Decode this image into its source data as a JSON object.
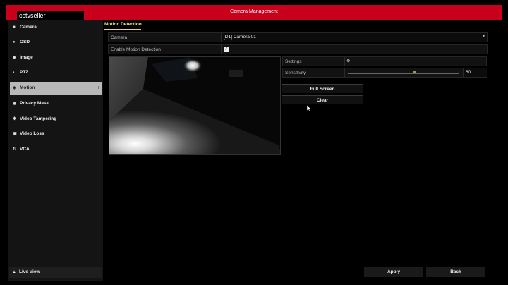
{
  "header": {
    "title": "Camera Management",
    "watermark": "cctvseller"
  },
  "sidebar": {
    "items": [
      {
        "label": "Camera",
        "icon": "camera-icon"
      },
      {
        "label": "OSD",
        "icon": "osd-icon"
      },
      {
        "label": "Image",
        "icon": "image-icon"
      },
      {
        "label": "PTZ",
        "icon": "ptz-icon"
      },
      {
        "label": "Motion",
        "icon": "motion-icon",
        "active": true
      },
      {
        "label": "Privacy Mask",
        "icon": "privacy-mask-icon"
      },
      {
        "label": "Video Tampering",
        "icon": "video-tampering-icon"
      },
      {
        "label": "Video Loss",
        "icon": "video-loss-icon"
      },
      {
        "label": "VCA",
        "icon": "vca-icon"
      }
    ],
    "live_view": "Live View"
  },
  "tabs": {
    "active": "Motion Detection"
  },
  "form": {
    "camera_label": "Camera",
    "camera_value": "[D1] Camera 01",
    "enable_label": "Enable Motion Detection",
    "enable_checked": true
  },
  "settings": {
    "settings_label": "Settings",
    "sensitivity_label": "Sensitivity",
    "sensitivity_value": "60",
    "sensitivity_level": 0.6
  },
  "buttons": {
    "full_screen": "Full Screen",
    "clear": "Clear",
    "apply": "Apply",
    "back": "Back"
  },
  "colors": {
    "accent": "#c8001c",
    "tab_active": "#f0e07a"
  }
}
